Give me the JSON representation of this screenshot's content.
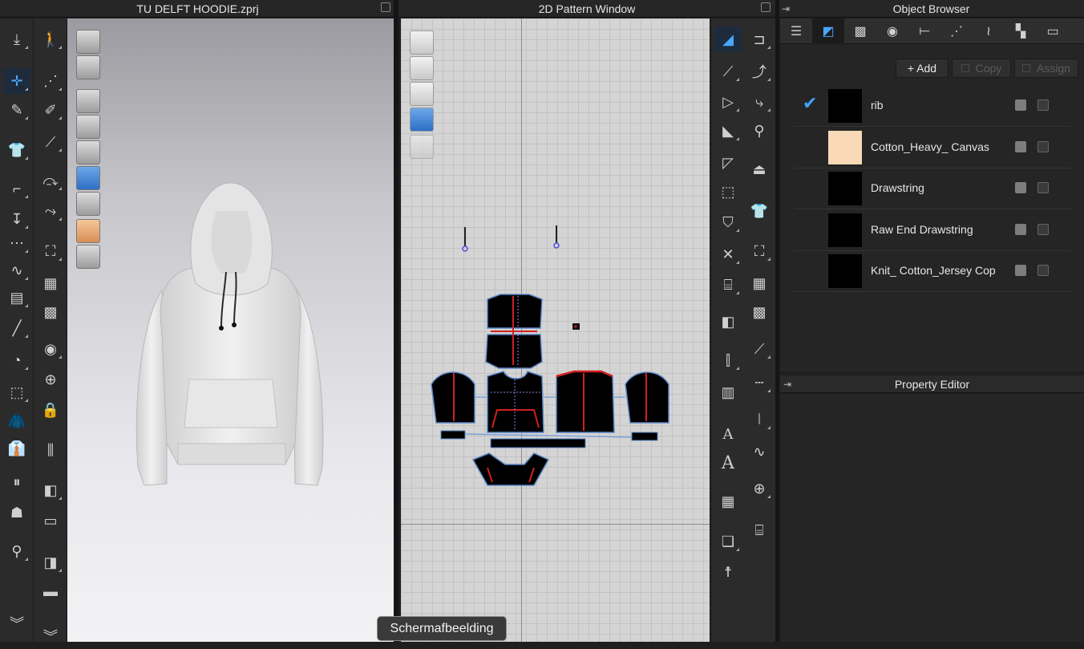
{
  "windows": {
    "viewport_3d_title": "TU DELFT HOODIE.zprj",
    "pattern_title": "2D Pattern Window",
    "object_browser_title": "Object Browser",
    "property_editor_title": "Property Editor"
  },
  "object_browser": {
    "add_label": "+ Add",
    "copy_label": "Copy",
    "assign_label": "Assign",
    "fabrics": [
      {
        "name": "rib",
        "color": "#000000",
        "checked": true
      },
      {
        "name": "Cotton_Heavy_ Canvas",
        "color": "#f9d9b7",
        "checked": false
      },
      {
        "name": "Drawstring",
        "color": "#000000",
        "checked": false
      },
      {
        "name": "Raw End Drawstring",
        "color": "#000000",
        "checked": false
      },
      {
        "name": "Knit_ Cotton_Jersey Cop",
        "color": "#000000",
        "checked": false
      }
    ]
  },
  "tooltip": "Schermafbeelding",
  "colors": {
    "accent": "#3fa3ff",
    "pattern_bg": "#d4d4d4",
    "piece_fill": "#000000",
    "seam_red": "#d02020"
  }
}
